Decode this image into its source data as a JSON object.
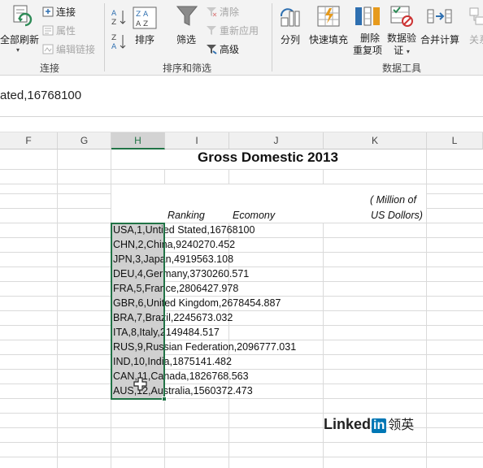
{
  "ribbon": {
    "connections_group": {
      "refresh_all": "全部刷新",
      "connections": "连接",
      "properties": "属性",
      "edit_links": "编辑链接",
      "group_label": "连接"
    },
    "sort_filter_group": {
      "sort": "排序",
      "filter": "筛选",
      "clear": "清除",
      "reapply": "重新应用",
      "advanced": "高级",
      "group_label": "排序和筛选"
    },
    "data_tools_group": {
      "text_to_columns": "分列",
      "flash_fill": "快速填充",
      "remove_duplicates_line1": "删除",
      "remove_duplicates_line2": "重复项",
      "data_validation_line1": "数据验",
      "data_validation_line2": "证",
      "consolidate": "合并计算",
      "relationships": "关系",
      "group_label": "数据工具"
    }
  },
  "formula_bar": {
    "value": "ated,16768100"
  },
  "columns": [
    "F",
    "G",
    "H",
    "I",
    "J",
    "K",
    "L"
  ],
  "selected_column": "H",
  "sheet": {
    "title": "Gross Domestic 2013",
    "unit_line1": "( Million of",
    "unit_line2": "US Dollors)",
    "header_ranking": "Ranking",
    "header_economy": "Ecomony",
    "rows": [
      "USA,1,Untied Stated,16768100",
      "CHN,2,China,9240270.452",
      "JPN,3,Japan,4919563.108",
      "DEU,4,Germany,3730260.571",
      "FRA,5,France,2806427.978",
      "GBR,6,United Kingdom,2678454.887",
      "BRA,7,Brazil,2245673.032",
      "ITA,8,Italy,2149484.517",
      "RUS,9,Russian Federation,2096777.031",
      "IND,10,India,1875141.482",
      "CAN,11,Canada,1826768.563",
      "AUS,12,Australia,1560372.473"
    ]
  },
  "watermark": {
    "brand": "Linked",
    "brand_box": "in",
    "brand_cn": "领英"
  },
  "colors": {
    "accent": "#217346",
    "selection_fill": "#d0d0d0",
    "linkedin_blue": "#0077b5"
  }
}
